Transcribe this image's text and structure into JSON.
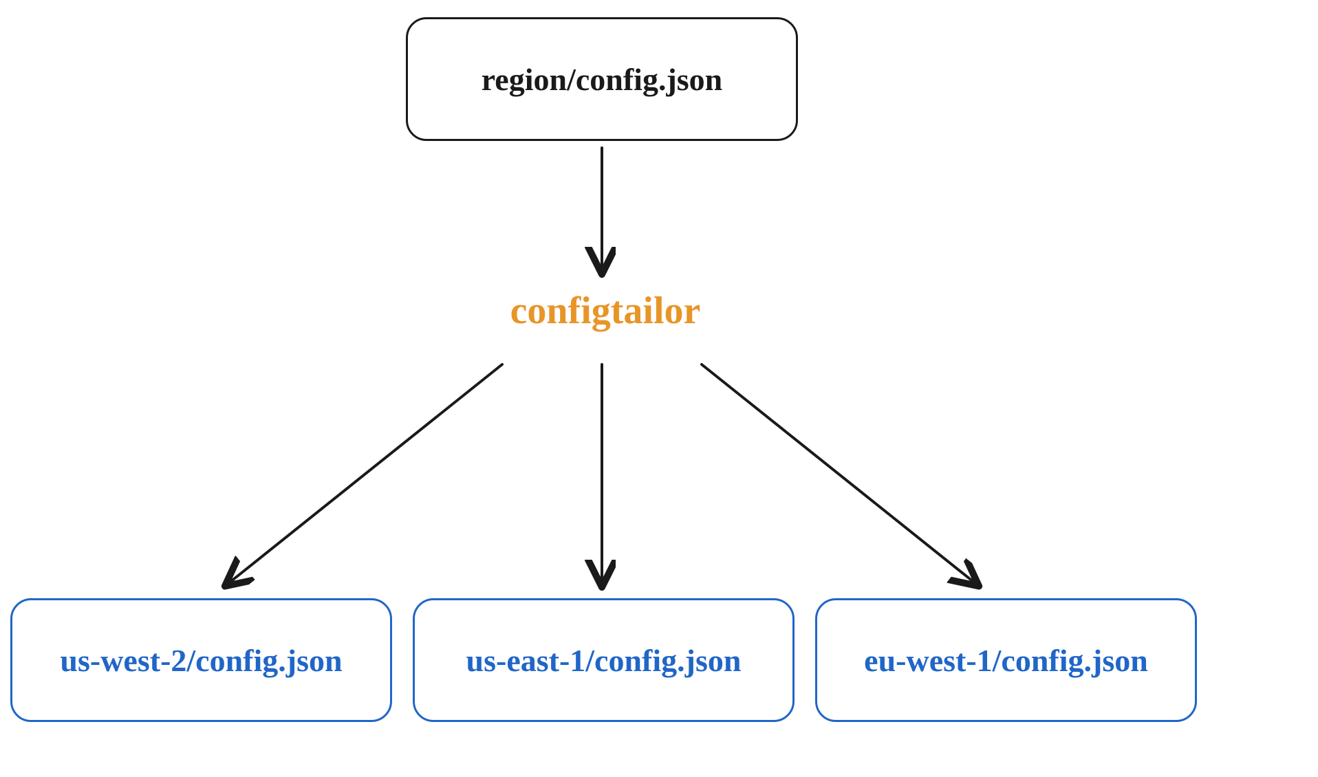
{
  "diagram": {
    "source_node": "region/config.json",
    "processor": "configtailor",
    "output_nodes": [
      "us-west-2/config.json",
      "us-east-1/config.json",
      "eu-west-1/config.json"
    ],
    "colors": {
      "source_border": "#1a1a1a",
      "output_border": "#2066c8",
      "processor_text": "#e89528",
      "arrow": "#1a1a1a"
    }
  }
}
